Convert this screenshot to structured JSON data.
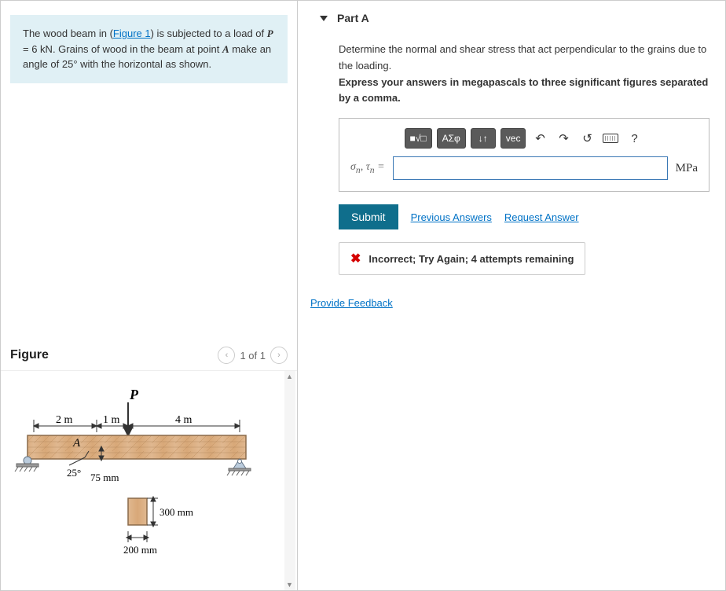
{
  "problem": {
    "pre": "The wood beam in (",
    "figure_link": "Figure 1",
    "post_link": ") is subjected to a load of ",
    "p_lhs": "P",
    "p_eq": " = 6 kN",
    "post_eq": ". Grains of wood in the beam at point ",
    "point": "A",
    "post_point": " make an angle of 25° with the horizontal as shown."
  },
  "figure": {
    "title": "Figure",
    "counter": "1 of 1",
    "labels": {
      "P": "P",
      "d2m": "2 m",
      "d1m": "1 m",
      "d4m": "4 m",
      "A": "A",
      "angle": "25°",
      "h75": "75 mm",
      "h300": "300 mm",
      "w200": "200 mm"
    }
  },
  "part": {
    "label": "Part A",
    "instr1": "Determine the normal and shear stress that act perpendicular to the grains due to the loading.",
    "instr2": "Express your answers in megapascals to three significant figures separated by a comma.",
    "toolbar": {
      "templates_label": "■√□",
      "greek_label": "ΑΣφ",
      "subsup_label": "↓↑",
      "vec_label": "vec",
      "help_label": "?"
    },
    "lhs": "σn, τn =",
    "unit": "MPa",
    "submit_label": "Submit",
    "prev_label": "Previous Answers",
    "req_label": "Request Answer",
    "feedback": "Incorrect; Try Again; 4 attempts remaining",
    "input_value": ""
  },
  "provide_feedback": "Provide Feedback"
}
